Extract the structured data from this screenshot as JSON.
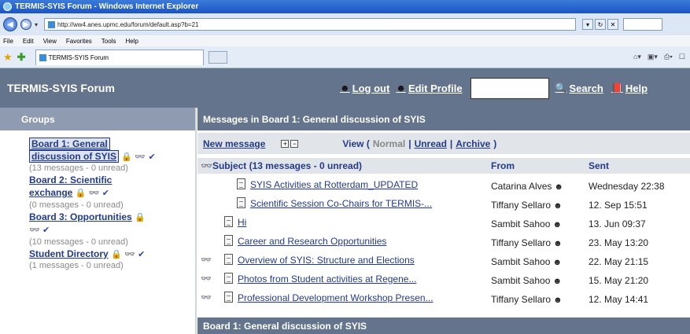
{
  "browser": {
    "window_title": "TERMIS-SYIS Forum - Windows Internet Explorer",
    "url": "http://ww4.anes.upmc.edu/forum/default.asp?b=21",
    "menu": [
      "File",
      "Edit",
      "View",
      "Favorites",
      "Tools",
      "Help"
    ],
    "tab_title": "TERMIS-SYIS Forum"
  },
  "header": {
    "forum_title": "TERMIS-SYIS Forum",
    "logout": "Log out",
    "edit_profile": "Edit Profile",
    "search_value": "",
    "search": "Search",
    "help": "Help"
  },
  "groups": {
    "title": "Groups",
    "boards": [
      {
        "name_line1": "Board 1: General",
        "name_line2": "discussion of SYIS",
        "meta": "(13 messages - 0 unread)"
      },
      {
        "name_line1": "Board 2: Scientific",
        "name_line2": "exchange",
        "meta": "(0 messages - 0 unread)"
      },
      {
        "name_line1": "Board 3: Opportunities",
        "name_line2": "",
        "meta": "(10 messages - 0 unread)"
      },
      {
        "name_line1": "Student Directory",
        "name_line2": "",
        "meta": "(1 messages - 0 unread)"
      }
    ]
  },
  "messages": {
    "title": "Messages in Board 1: General discussion of SYIS",
    "new_message": "New message",
    "view_label": "View (",
    "view_normal": "Normal",
    "view_unread": "Unread",
    "view_archive": "Archive",
    "view_close": ")",
    "col_subject": "Subject (13  messages  - 0  unread)",
    "col_from": "From",
    "col_sent": "Sent",
    "rows": [
      {
        "subject": "SYIS Activities at Rotterdam_UPDATED",
        "from": "Catarina Alves",
        "sent": "Wednesday  22:38",
        "watched": false,
        "indent": 2
      },
      {
        "subject": "Scientific Session Co-Chairs for TERMIS-...",
        "from": "Tiffany Sellaro",
        "sent": "12. Sep 15:51",
        "watched": false,
        "indent": 2
      },
      {
        "subject": "Hi",
        "from": "Sambit Sahoo",
        "sent": "13. Jun 09:37",
        "watched": false,
        "indent": 1
      },
      {
        "subject": "Career and Research Opportunities",
        "from": "Tiffany Sellaro",
        "sent": "23. May 13:20",
        "watched": false,
        "indent": 1
      },
      {
        "subject": "Overview of SYIS: Structure and Elections",
        "from": "Sambit Sahoo",
        "sent": "22. May 21:15",
        "watched": true,
        "indent": 1
      },
      {
        "subject": "Photos from Student activities at Regene...",
        "from": "Sambit Sahoo",
        "sent": "15. May 21:20",
        "watched": true,
        "indent": 1
      },
      {
        "subject": "Professional Development Workshop Presen...",
        "from": "Tiffany Sellaro",
        "sent": "12. May 14:41",
        "watched": true,
        "indent": 1
      }
    ],
    "footer": "Board 1: General discussion of SYIS"
  }
}
